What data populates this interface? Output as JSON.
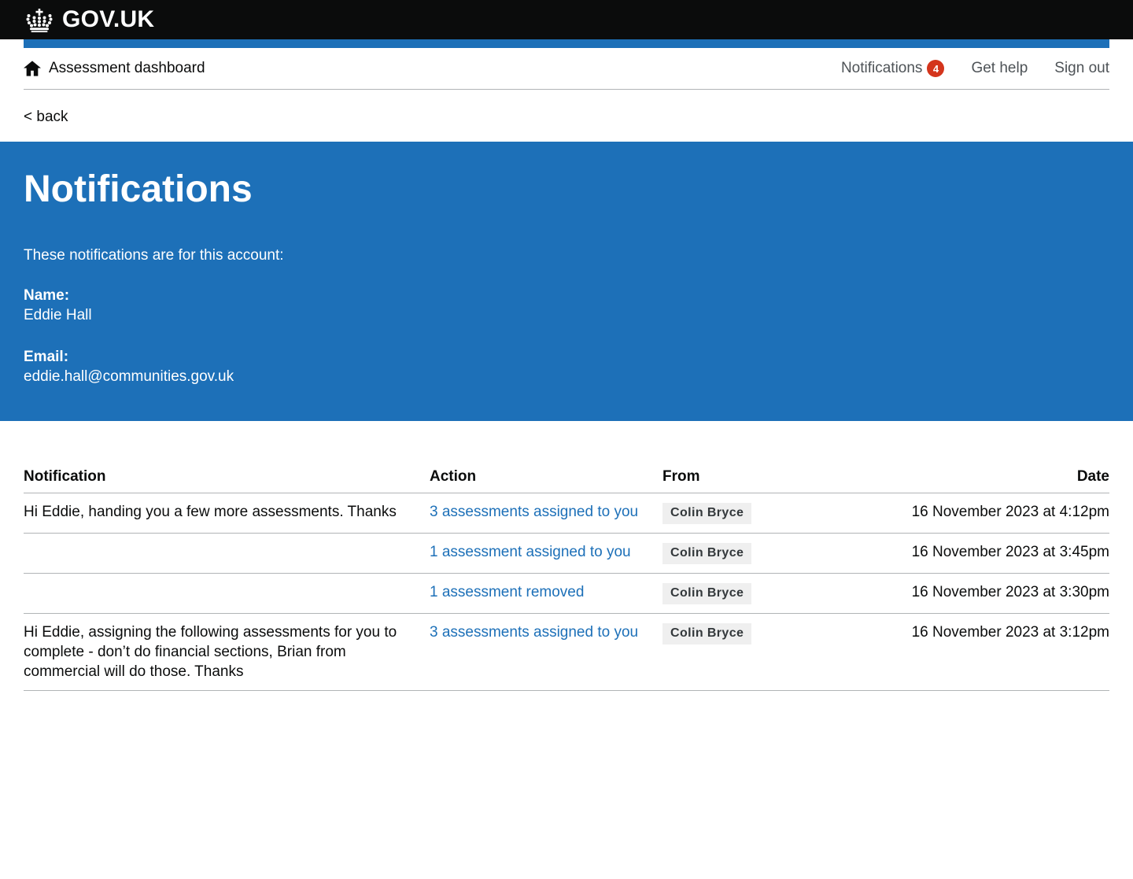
{
  "header": {
    "logo_text": "GOV.UK"
  },
  "nav": {
    "dashboard_label": "Assessment dashboard",
    "notifications_label": "Notifications",
    "notifications_count": "4",
    "get_help_label": "Get help",
    "sign_out_label": "Sign out"
  },
  "back_link_label": "< back",
  "hero": {
    "title": "Notifications",
    "intro": "These notifications are for this account:",
    "name_label": "Name:",
    "name_value": "Eddie Hall",
    "email_label": "Email:",
    "email_value": "eddie.hall@communities.gov.uk"
  },
  "table": {
    "headers": {
      "notification": "Notification",
      "action": "Action",
      "from": "From",
      "date": "Date"
    },
    "rows": [
      {
        "notification": "Hi Eddie, handing you a few more assessments. Thanks",
        "action": "3 assessments assigned to you",
        "from": "Colin Bryce",
        "date": "16 November 2023 at 4:12pm"
      },
      {
        "notification": "",
        "action": "1 assessment assigned to you",
        "from": "Colin Bryce",
        "date": "16 November 2023 at 3:45pm"
      },
      {
        "notification": "",
        "action": "1 assessment removed",
        "from": "Colin Bryce",
        "date": "16 November 2023 at 3:30pm"
      },
      {
        "notification": "Hi Eddie, assigning the following assessments for you to complete - don’t do financial sections, Brian from commercial will do those. Thanks",
        "action": "3 assessments assigned to you",
        "from": "Colin Bryce",
        "date": "16 November 2023 at 3:12pm"
      }
    ]
  },
  "icons": {
    "crown": "crown-icon",
    "home": "home-icon",
    "notification_badge": "notification-count-badge"
  },
  "colors": {
    "brand_blue": "#1d70b8",
    "text_black": "#0b0c0c",
    "link_blue": "#1d70b8",
    "badge_red": "#d4351c",
    "tag_bg": "#efefef",
    "tag_text": "#33383b",
    "border_grey": "#b1b4b6",
    "nav_grey": "#4e5357"
  }
}
